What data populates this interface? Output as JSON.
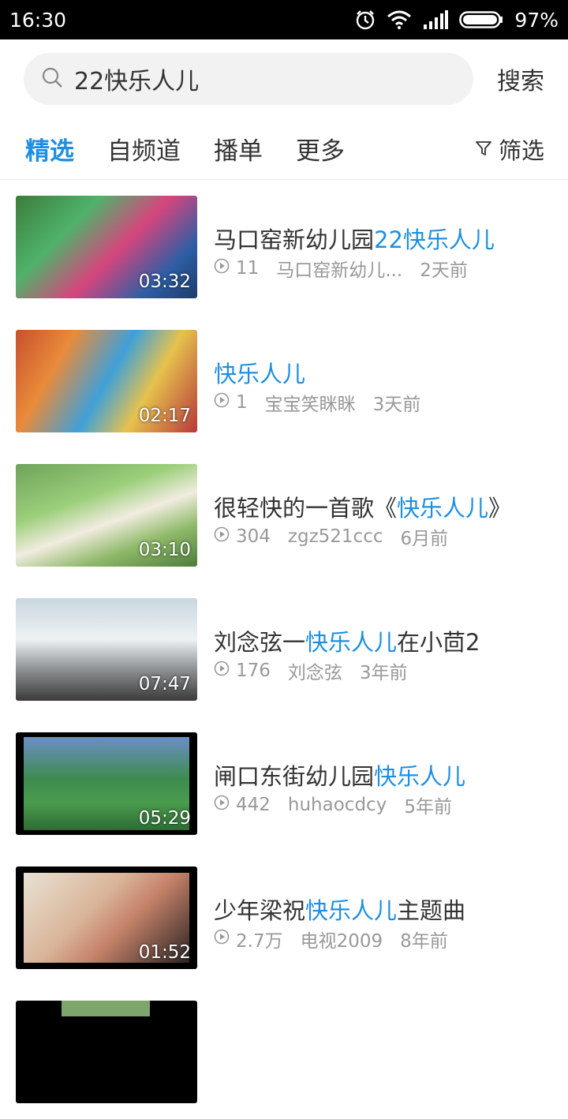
{
  "status_bar": {
    "time": "16:30",
    "battery": "97%",
    "icons": [
      "alarm-icon",
      "wifi-icon",
      "signal-icon",
      "battery-icon"
    ]
  },
  "search": {
    "query": "22快乐人儿",
    "button_label": "搜索"
  },
  "tabs": [
    {
      "label": "精选",
      "active": true
    },
    {
      "label": "自频道",
      "active": false
    },
    {
      "label": "播单",
      "active": false
    },
    {
      "label": "更多",
      "active": false
    }
  ],
  "filter_label": "筛选",
  "colors": {
    "accent": "#1e8fe0",
    "text": "#333333",
    "meta": "#999999"
  },
  "results": [
    {
      "title_pre": "马口窑新幼儿园",
      "title_hl": "22快乐人儿",
      "title_post": "",
      "views": "11",
      "author": "马口窑新幼儿...",
      "time": "2天前",
      "duration": "03:32"
    },
    {
      "title_pre": "",
      "title_hl": "快乐人儿",
      "title_post": "",
      "views": "1",
      "author": "宝宝笑眯眯",
      "time": "3天前",
      "duration": "02:17"
    },
    {
      "title_pre": "很轻快的一首歌《",
      "title_hl": "快乐人儿",
      "title_post": "》",
      "views": "304",
      "author": "zgz521ccc",
      "time": "6月前",
      "duration": "03:10"
    },
    {
      "title_pre": "刘念弦一",
      "title_hl": "快乐人儿",
      "title_post": "在小茴2",
      "views": "176",
      "author": "刘念弦",
      "time": "3年前",
      "duration": "07:47"
    },
    {
      "title_pre": "闸口东街幼儿园",
      "title_hl": "快乐人儿",
      "title_post": "",
      "views": "442",
      "author": "huhaocdcy",
      "time": "5年前",
      "duration": "05:29"
    },
    {
      "title_pre": "少年梁祝",
      "title_hl": "快乐人儿",
      "title_post": "主题曲",
      "views": "2.7万",
      "author": "电视2009",
      "time": "8年前",
      "duration": "01:52"
    }
  ]
}
